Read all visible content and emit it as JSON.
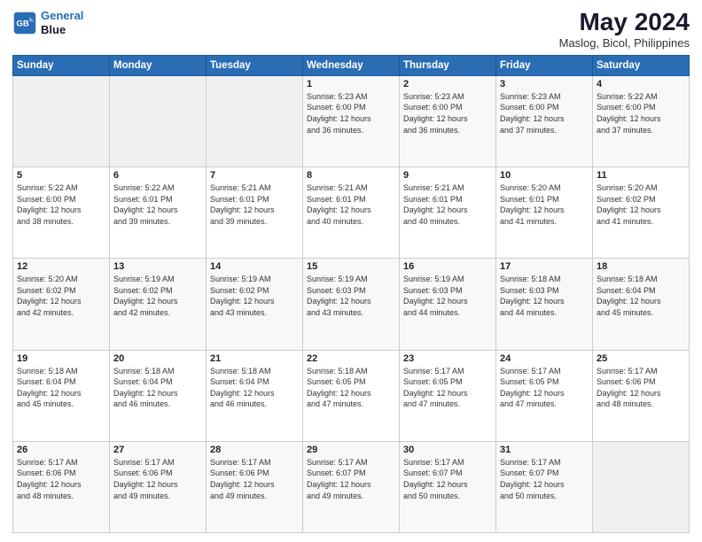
{
  "header": {
    "logo_line1": "General",
    "logo_line2": "Blue",
    "month_year": "May 2024",
    "location": "Maslog, Bicol, Philippines"
  },
  "days_of_week": [
    "Sunday",
    "Monday",
    "Tuesday",
    "Wednesday",
    "Thursday",
    "Friday",
    "Saturday"
  ],
  "weeks": [
    [
      {
        "day": "",
        "content": ""
      },
      {
        "day": "",
        "content": ""
      },
      {
        "day": "",
        "content": ""
      },
      {
        "day": "1",
        "content": "Sunrise: 5:23 AM\nSunset: 6:00 PM\nDaylight: 12 hours\nand 36 minutes."
      },
      {
        "day": "2",
        "content": "Sunrise: 5:23 AM\nSunset: 6:00 PM\nDaylight: 12 hours\nand 36 minutes."
      },
      {
        "day": "3",
        "content": "Sunrise: 5:23 AM\nSunset: 6:00 PM\nDaylight: 12 hours\nand 37 minutes."
      },
      {
        "day": "4",
        "content": "Sunrise: 5:22 AM\nSunset: 6:00 PM\nDaylight: 12 hours\nand 37 minutes."
      }
    ],
    [
      {
        "day": "5",
        "content": "Sunrise: 5:22 AM\nSunset: 6:00 PM\nDaylight: 12 hours\nand 38 minutes."
      },
      {
        "day": "6",
        "content": "Sunrise: 5:22 AM\nSunset: 6:01 PM\nDaylight: 12 hours\nand 39 minutes."
      },
      {
        "day": "7",
        "content": "Sunrise: 5:21 AM\nSunset: 6:01 PM\nDaylight: 12 hours\nand 39 minutes."
      },
      {
        "day": "8",
        "content": "Sunrise: 5:21 AM\nSunset: 6:01 PM\nDaylight: 12 hours\nand 40 minutes."
      },
      {
        "day": "9",
        "content": "Sunrise: 5:21 AM\nSunset: 6:01 PM\nDaylight: 12 hours\nand 40 minutes."
      },
      {
        "day": "10",
        "content": "Sunrise: 5:20 AM\nSunset: 6:01 PM\nDaylight: 12 hours\nand 41 minutes."
      },
      {
        "day": "11",
        "content": "Sunrise: 5:20 AM\nSunset: 6:02 PM\nDaylight: 12 hours\nand 41 minutes."
      }
    ],
    [
      {
        "day": "12",
        "content": "Sunrise: 5:20 AM\nSunset: 6:02 PM\nDaylight: 12 hours\nand 42 minutes."
      },
      {
        "day": "13",
        "content": "Sunrise: 5:19 AM\nSunset: 6:02 PM\nDaylight: 12 hours\nand 42 minutes."
      },
      {
        "day": "14",
        "content": "Sunrise: 5:19 AM\nSunset: 6:02 PM\nDaylight: 12 hours\nand 43 minutes."
      },
      {
        "day": "15",
        "content": "Sunrise: 5:19 AM\nSunset: 6:03 PM\nDaylight: 12 hours\nand 43 minutes."
      },
      {
        "day": "16",
        "content": "Sunrise: 5:19 AM\nSunset: 6:03 PM\nDaylight: 12 hours\nand 44 minutes."
      },
      {
        "day": "17",
        "content": "Sunrise: 5:18 AM\nSunset: 6:03 PM\nDaylight: 12 hours\nand 44 minutes."
      },
      {
        "day": "18",
        "content": "Sunrise: 5:18 AM\nSunset: 6:04 PM\nDaylight: 12 hours\nand 45 minutes."
      }
    ],
    [
      {
        "day": "19",
        "content": "Sunrise: 5:18 AM\nSunset: 6:04 PM\nDaylight: 12 hours\nand 45 minutes."
      },
      {
        "day": "20",
        "content": "Sunrise: 5:18 AM\nSunset: 6:04 PM\nDaylight: 12 hours\nand 46 minutes."
      },
      {
        "day": "21",
        "content": "Sunrise: 5:18 AM\nSunset: 6:04 PM\nDaylight: 12 hours\nand 46 minutes."
      },
      {
        "day": "22",
        "content": "Sunrise: 5:18 AM\nSunset: 6:05 PM\nDaylight: 12 hours\nand 47 minutes."
      },
      {
        "day": "23",
        "content": "Sunrise: 5:17 AM\nSunset: 6:05 PM\nDaylight: 12 hours\nand 47 minutes."
      },
      {
        "day": "24",
        "content": "Sunrise: 5:17 AM\nSunset: 6:05 PM\nDaylight: 12 hours\nand 47 minutes."
      },
      {
        "day": "25",
        "content": "Sunrise: 5:17 AM\nSunset: 6:06 PM\nDaylight: 12 hours\nand 48 minutes."
      }
    ],
    [
      {
        "day": "26",
        "content": "Sunrise: 5:17 AM\nSunset: 6:06 PM\nDaylight: 12 hours\nand 48 minutes."
      },
      {
        "day": "27",
        "content": "Sunrise: 5:17 AM\nSunset: 6:06 PM\nDaylight: 12 hours\nand 49 minutes."
      },
      {
        "day": "28",
        "content": "Sunrise: 5:17 AM\nSunset: 6:06 PM\nDaylight: 12 hours\nand 49 minutes."
      },
      {
        "day": "29",
        "content": "Sunrise: 5:17 AM\nSunset: 6:07 PM\nDaylight: 12 hours\nand 49 minutes."
      },
      {
        "day": "30",
        "content": "Sunrise: 5:17 AM\nSunset: 6:07 PM\nDaylight: 12 hours\nand 50 minutes."
      },
      {
        "day": "31",
        "content": "Sunrise: 5:17 AM\nSunset: 6:07 PM\nDaylight: 12 hours\nand 50 minutes."
      },
      {
        "day": "",
        "content": ""
      }
    ]
  ]
}
